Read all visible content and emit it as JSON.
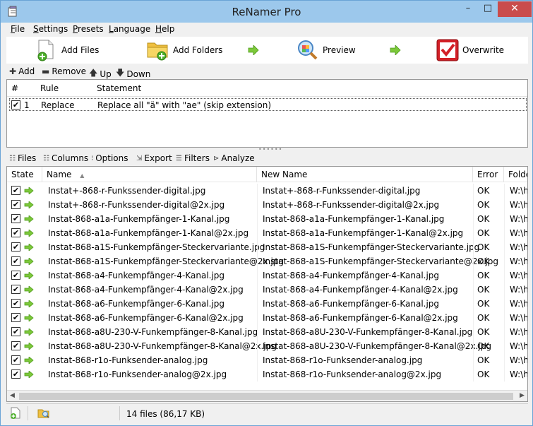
{
  "window": {
    "title": "ReNamer Pro",
    "min": "–",
    "max": "□",
    "close": "✕"
  },
  "menu": [
    {
      "label_u": "F",
      "label_rest": "ile"
    },
    {
      "label_u": "S",
      "label_rest": "ettings"
    },
    {
      "label_u": "P",
      "label_rest": "resets"
    },
    {
      "label_u": "L",
      "label_rest": "anguage"
    },
    {
      "label_u": "H",
      "label_rest": "elp"
    }
  ],
  "toolbar": {
    "add_files": "Add Files",
    "add_folders": "Add Folders",
    "preview": "Preview",
    "overwrite": "Overwrite"
  },
  "rulebar": {
    "add": "Add",
    "remove": "Remove",
    "up": "Up",
    "down": "Down"
  },
  "rules": {
    "headers": {
      "num": "#",
      "rule": "Rule",
      "statement": "Statement"
    },
    "rows": [
      {
        "checked": "✔",
        "num": "1",
        "rule": "Replace",
        "statement": "Replace all \"ä\" with \"ae\" (skip extension)"
      }
    ]
  },
  "filesbar": {
    "files": "Files",
    "columns": "Columns",
    "options": "Options",
    "export": "Export",
    "filters": "Filters",
    "analyze": "Analyze"
  },
  "files": {
    "headers": {
      "state": "State",
      "name": "Name",
      "sort": "▲",
      "new_name": "New Name",
      "error": "Error",
      "folder": "Folde"
    },
    "rows": [
      {
        "name": "Instat+-868-r-Funkssender-digital.jpg",
        "new_name": "Instat+-868-r-Funkssender-digital.jpg",
        "error": "OK",
        "folder": "W:\\h"
      },
      {
        "name": "Instat+-868-r-Funkssender-digital@2x.jpg",
        "new_name": "Instat+-868-r-Funkssender-digital@2x.jpg",
        "error": "OK",
        "folder": "W:\\h"
      },
      {
        "name": "Instat-868-a1a-Funkempfänger-1-Kanal.jpg",
        "new_name": "Instat-868-a1a-Funkempfänger-1-Kanal.jpg",
        "error": "OK",
        "folder": "W:\\h"
      },
      {
        "name": "Instat-868-a1a-Funkempfänger-1-Kanal@2x.jpg",
        "new_name": "Instat-868-a1a-Funkempfänger-1-Kanal@2x.jpg",
        "error": "OK",
        "folder": "W:\\h"
      },
      {
        "name": "Instat-868-a1S-Funkempfänger-Steckervariante.jpg",
        "new_name": "Instat-868-a1S-Funkempfänger-Steckervariante.jpg",
        "error": "OK",
        "folder": "W:\\h"
      },
      {
        "name": "Instat-868-a1S-Funkempfänger-Steckervariante@2x.jpg",
        "new_name": "Instat-868-a1S-Funkempfänger-Steckervariante@2x.jpg",
        "error": "OK",
        "folder": "W:\\h"
      },
      {
        "name": "Instat-868-a4-Funkempfänger-4-Kanal.jpg",
        "new_name": "Instat-868-a4-Funkempfänger-4-Kanal.jpg",
        "error": "OK",
        "folder": "W:\\h"
      },
      {
        "name": "Instat-868-a4-Funkempfänger-4-Kanal@2x.jpg",
        "new_name": "Instat-868-a4-Funkempfänger-4-Kanal@2x.jpg",
        "error": "OK",
        "folder": "W:\\h"
      },
      {
        "name": "Instat-868-a6-Funkempfänger-6-Kanal.jpg",
        "new_name": "Instat-868-a6-Funkempfänger-6-Kanal.jpg",
        "error": "OK",
        "folder": "W:\\h"
      },
      {
        "name": "Instat-868-a6-Funkempfänger-6-Kanal@2x.jpg",
        "new_name": "Instat-868-a6-Funkempfänger-6-Kanal@2x.jpg",
        "error": "OK",
        "folder": "W:\\h"
      },
      {
        "name": "Instat-868-a8U-230-V-Funkempfänger-8-Kanal.jpg",
        "new_name": "Instat-868-a8U-230-V-Funkempfänger-8-Kanal.jpg",
        "error": "OK",
        "folder": "W:\\h"
      },
      {
        "name": "Instat-868-a8U-230-V-Funkempfänger-8-Kanal@2x.jpg",
        "new_name": "Instat-868-a8U-230-V-Funkempfänger-8-Kanal@2x.jpg",
        "error": "OK",
        "folder": "W:\\h"
      },
      {
        "name": "Instat-868-r1o-Funksender-analog.jpg",
        "new_name": "Instat-868-r1o-Funksender-analog.jpg",
        "error": "OK",
        "folder": "W:\\h"
      },
      {
        "name": "Instat-868-r1o-Funksender-analog@2x.jpg",
        "new_name": "Instat-868-r1o-Funksender-analog@2x.jpg",
        "error": "OK",
        "folder": "W:\\h"
      }
    ]
  },
  "status": {
    "summary": "14 files (86,17 KB)"
  },
  "colors": {
    "titlebar": "#9cc8ec",
    "close": "#c94c4c",
    "arrow": "#6cc02c",
    "overwrite": "#d32027"
  }
}
